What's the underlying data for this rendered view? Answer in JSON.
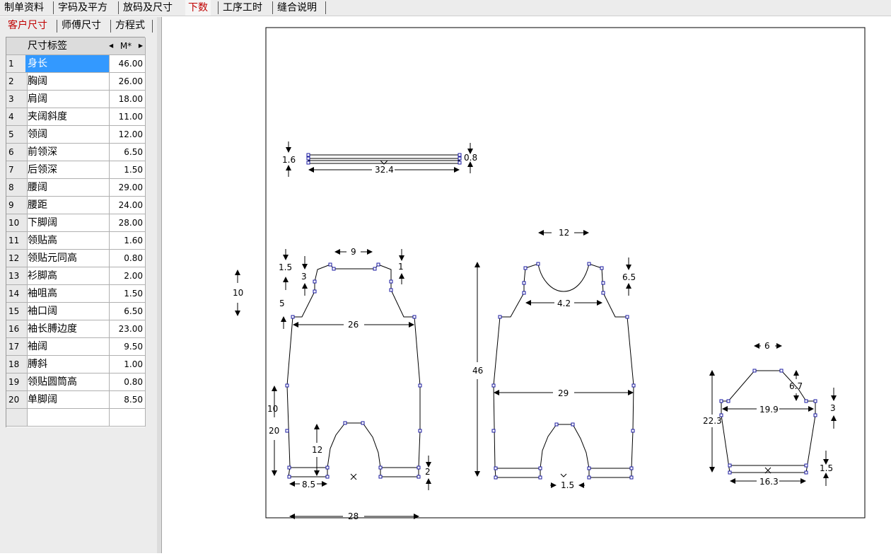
{
  "top_tabs": [
    "制单资料",
    "字码及平方",
    "放码及尺寸",
    "下数",
    "工序工时",
    "缝合说明"
  ],
  "sub_tabs": [
    "客户尺寸",
    "师傅尺寸",
    "方程式"
  ],
  "table": {
    "header_label": "尺寸标签",
    "header_size": "M*",
    "rows": [
      {
        "n": "1",
        "label": "身长",
        "value": "46.00"
      },
      {
        "n": "2",
        "label": "胸阔",
        "value": "26.00"
      },
      {
        "n": "3",
        "label": "肩阔",
        "value": "18.00"
      },
      {
        "n": "4",
        "label": "夹阔斜度",
        "value": "11.00"
      },
      {
        "n": "5",
        "label": "领阔",
        "value": "12.00"
      },
      {
        "n": "6",
        "label": "前领深",
        "value": "6.50"
      },
      {
        "n": "7",
        "label": "后领深",
        "value": "1.50"
      },
      {
        "n": "8",
        "label": "腰阔",
        "value": "29.00"
      },
      {
        "n": "9",
        "label": "腰距",
        "value": "24.00"
      },
      {
        "n": "10",
        "label": "下脚阔",
        "value": "28.00"
      },
      {
        "n": "11",
        "label": "领贴高",
        "value": "1.60"
      },
      {
        "n": "12",
        "label": "领贴元同高",
        "value": "0.80"
      },
      {
        "n": "13",
        "label": "衫脚高",
        "value": "2.00"
      },
      {
        "n": "14",
        "label": "袖咀高",
        "value": "1.50"
      },
      {
        "n": "15",
        "label": "袖口阔",
        "value": "6.50"
      },
      {
        "n": "16",
        "label": "袖长膊边度",
        "value": "23.00"
      },
      {
        "n": "17",
        "label": "袖阔",
        "value": "9.50"
      },
      {
        "n": "18",
        "label": "膊斜",
        "value": "1.00"
      },
      {
        "n": "19",
        "label": "领贴圆筒高",
        "value": "0.80"
      },
      {
        "n": "20",
        "label": "单脚阔",
        "value": "8.50"
      }
    ]
  },
  "drawing": {
    "dims": [
      "1.6",
      "0.8",
      "32.4",
      "10",
      "9",
      "1.5",
      "3",
      "1",
      "5",
      "26",
      "10",
      "20",
      "12",
      "8.5",
      "2",
      "28",
      "12",
      "6.5",
      "4.2",
      "46",
      "29",
      "1.5",
      "6",
      "6.7",
      "19.9",
      "3",
      "22.3",
      "16.3",
      "1.5"
    ]
  }
}
